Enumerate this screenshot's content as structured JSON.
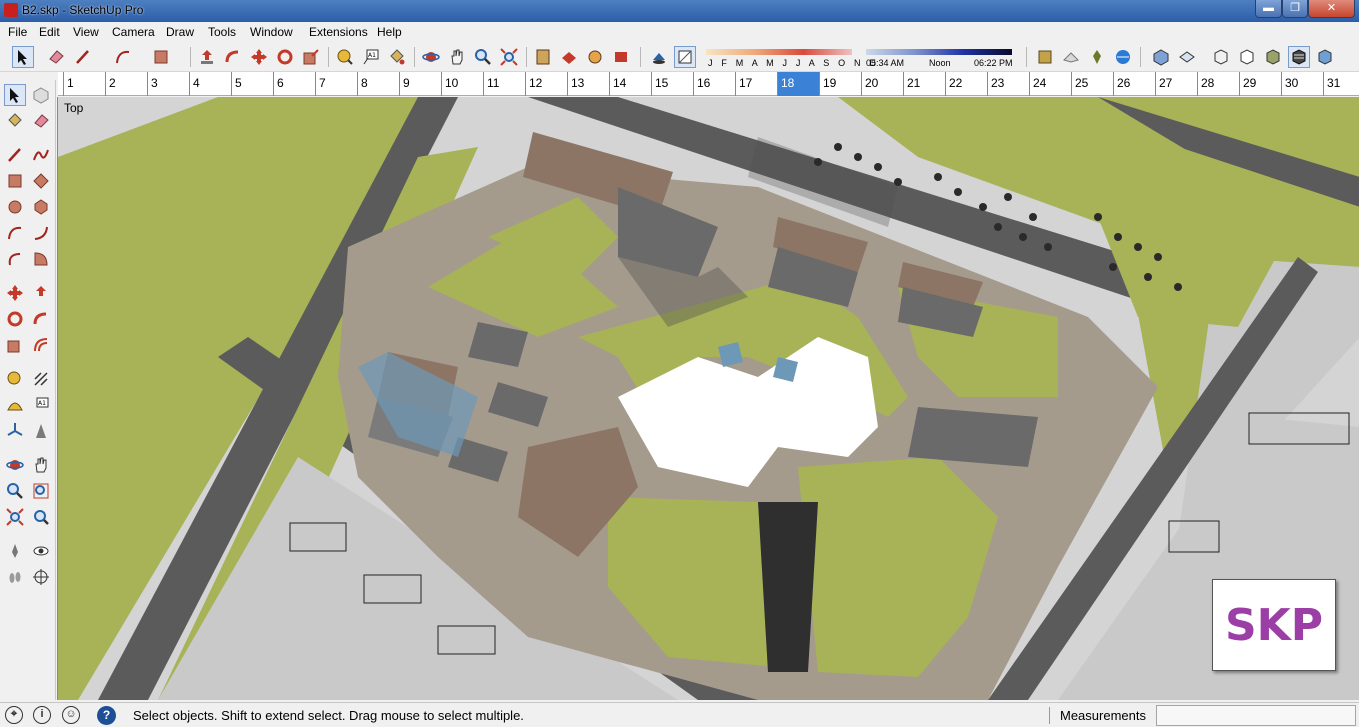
{
  "window": {
    "title": "B2.skp - SketchUp Pro",
    "minimize": "▬",
    "maximize": "❐",
    "close": "✕"
  },
  "menu": [
    "File",
    "Edit",
    "View",
    "Camera",
    "Draw",
    "Tools",
    "Window",
    "Extensions",
    "Help"
  ],
  "shadow_settings": {
    "months": "J F M A M J J A S O N D",
    "time_start": "05:34 AM",
    "time_mid": "Noon",
    "time_end": "06:22 PM"
  },
  "ruler": {
    "ticks": [
      "1",
      "2",
      "3",
      "4",
      "5",
      "6",
      "7",
      "8",
      "9",
      "10",
      "11",
      "12",
      "13",
      "14",
      "15",
      "16",
      "17",
      "18",
      "19",
      "20",
      "21",
      "22",
      "23",
      "24",
      "25",
      "26",
      "27",
      "28",
      "29",
      "30",
      "31"
    ],
    "selected": "18"
  },
  "viewport": {
    "view_label": "Top",
    "watermark": "SKP"
  },
  "status": {
    "hint": "Select objects. Shift to extend select. Drag mouse to select multiple.",
    "measurements_label": "Measurements",
    "measurements_value": "",
    "icons": [
      "geo-location-icon",
      "info-icon",
      "user-icon",
      "help-icon"
    ]
  },
  "colors": {
    "grass": "#a9b359",
    "road": "#5a5a5a",
    "paving": "#a89e8f",
    "roof": "#8a7263",
    "accent": "#9b3fa7"
  }
}
